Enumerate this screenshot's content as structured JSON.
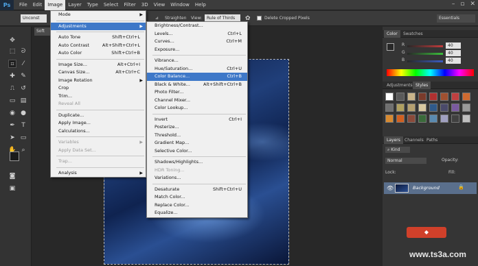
{
  "app": {
    "logo": "Ps"
  },
  "menubar": {
    "items": [
      "File",
      "Edit",
      "Image",
      "Layer",
      "Type",
      "Select",
      "Filter",
      "3D",
      "View",
      "Window",
      "Help"
    ],
    "active": "Image"
  },
  "optionsbar": {
    "unconstrained": "Unconst",
    "straighten": "Straighten",
    "view_label": "View:",
    "view_value": "Rule of Thirds",
    "delete_cropped": "Delete Cropped Pixels",
    "workspace": "Essentials"
  },
  "document": {
    "tab_label": "Soft"
  },
  "image_menu": {
    "items": [
      {
        "label": "Mode",
        "shortcut": "",
        "submenu": true,
        "disabled": false
      },
      {
        "sep": true
      },
      {
        "label": "Adjustments",
        "shortcut": "",
        "submenu": true,
        "disabled": false,
        "highlight": true
      },
      {
        "sep": true
      },
      {
        "label": "Auto Tone",
        "shortcut": "Shift+Ctrl+L",
        "disabled": false
      },
      {
        "label": "Auto Contrast",
        "shortcut": "Alt+Shift+Ctrl+L",
        "disabled": false
      },
      {
        "label": "Auto Color",
        "shortcut": "Shift+Ctrl+B",
        "disabled": false
      },
      {
        "sep": true
      },
      {
        "label": "Image Size...",
        "shortcut": "Alt+Ctrl+I",
        "disabled": false
      },
      {
        "label": "Canvas Size...",
        "shortcut": "Alt+Ctrl+C",
        "disabled": false
      },
      {
        "label": "Image Rotation",
        "shortcut": "",
        "submenu": true,
        "disabled": false
      },
      {
        "label": "Crop",
        "shortcut": "",
        "disabled": false
      },
      {
        "label": "Trim...",
        "shortcut": "",
        "disabled": false
      },
      {
        "label": "Reveal All",
        "shortcut": "",
        "disabled": true
      },
      {
        "sep": true
      },
      {
        "label": "Duplicate...",
        "shortcut": "",
        "disabled": false
      },
      {
        "label": "Apply Image...",
        "shortcut": "",
        "disabled": false
      },
      {
        "label": "Calculations...",
        "shortcut": "",
        "disabled": false
      },
      {
        "sep": true
      },
      {
        "label": "Variables",
        "shortcut": "",
        "submenu": true,
        "disabled": true
      },
      {
        "label": "Apply Data Set...",
        "shortcut": "",
        "disabled": true
      },
      {
        "sep": true
      },
      {
        "label": "Trap...",
        "shortcut": "",
        "disabled": true
      },
      {
        "sep": true
      },
      {
        "label": "Analysis",
        "shortcut": "",
        "submenu": true,
        "disabled": false
      }
    ]
  },
  "adjustments_menu": {
    "items": [
      {
        "label": "Brightness/Contrast...",
        "shortcut": ""
      },
      {
        "label": "Levels...",
        "shortcut": "Ctrl+L"
      },
      {
        "label": "Curves...",
        "shortcut": "Ctrl+M"
      },
      {
        "label": "Exposure...",
        "shortcut": ""
      },
      {
        "sep": true
      },
      {
        "label": "Vibrance...",
        "shortcut": ""
      },
      {
        "label": "Hue/Saturation...",
        "shortcut": "Ctrl+U"
      },
      {
        "label": "Color Balance...",
        "shortcut": "Ctrl+B",
        "highlight": true
      },
      {
        "label": "Black & White...",
        "shortcut": "Alt+Shift+Ctrl+B"
      },
      {
        "label": "Photo Filter...",
        "shortcut": ""
      },
      {
        "label": "Channel Mixer...",
        "shortcut": ""
      },
      {
        "label": "Color Lookup...",
        "shortcut": ""
      },
      {
        "sep": true
      },
      {
        "label": "Invert",
        "shortcut": "Ctrl+I"
      },
      {
        "label": "Posterize...",
        "shortcut": ""
      },
      {
        "label": "Threshold...",
        "shortcut": ""
      },
      {
        "label": "Gradient Map...",
        "shortcut": ""
      },
      {
        "label": "Selective Color...",
        "shortcut": ""
      },
      {
        "sep": true
      },
      {
        "label": "Shadows/Highlights...",
        "shortcut": ""
      },
      {
        "label": "HDR Toning...",
        "shortcut": "",
        "disabled": true
      },
      {
        "label": "Variations...",
        "shortcut": ""
      },
      {
        "sep": true
      },
      {
        "label": "Desaturate",
        "shortcut": "Shift+Ctrl+U"
      },
      {
        "label": "Match Color...",
        "shortcut": ""
      },
      {
        "label": "Replace Color...",
        "shortcut": ""
      },
      {
        "label": "Equalize...",
        "shortcut": ""
      }
    ]
  },
  "color_panel": {
    "tabs": [
      "Color",
      "Swatches"
    ],
    "channels": [
      {
        "name": "R",
        "value": "40",
        "color": "#c23b3b"
      },
      {
        "name": "G",
        "value": "40",
        "color": "#3bbf3b"
      },
      {
        "name": "B",
        "value": "40",
        "color": "#3b5cc2"
      }
    ]
  },
  "adjustments_panel": {
    "tabs": [
      "Adjustments",
      "Styles"
    ]
  },
  "layers_panel": {
    "tabs": [
      "Layers",
      "Channels",
      "Paths"
    ],
    "kind": "Kind",
    "blend": "Normal",
    "opacity_label": "Opacity:",
    "lock_label": "Lock:",
    "fill_label": "Fill:",
    "layer_name": "Background"
  },
  "watermark": {
    "url": "www.ts3a.com"
  },
  "colors": {
    "accent": "#3e78c8",
    "menu_bg": "#f0f0f0",
    "ui_dark": "#353535"
  }
}
